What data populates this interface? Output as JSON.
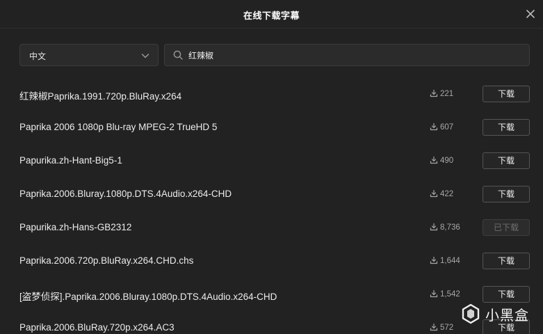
{
  "dialog": {
    "title": "在线下载字幕",
    "close_icon": "close-icon"
  },
  "controls": {
    "language": {
      "selected": "中文",
      "icon": "chevron-down-icon"
    },
    "search": {
      "value": "红辣椒",
      "placeholder": "",
      "icon": "search-icon"
    }
  },
  "results": [
    {
      "name": "红辣椒Paprika.1991.720p.BluRay.x264",
      "downloads": "221",
      "button": "下载",
      "downloaded": false
    },
    {
      "name": "Paprika 2006 1080p Blu-ray MPEG-2 TrueHD 5",
      "downloads": "607",
      "button": "下载",
      "downloaded": false
    },
    {
      "name": "Papurika.zh-Hant-Big5-1",
      "downloads": "490",
      "button": "下载",
      "downloaded": false
    },
    {
      "name": "Paprika.2006.Bluray.1080p.DTS.4Audio.x264-CHD",
      "downloads": "422",
      "button": "下载",
      "downloaded": false
    },
    {
      "name": "Papurika.zh-Hans-GB2312",
      "downloads": "8,736",
      "button": "已下载",
      "downloaded": true
    },
    {
      "name": "Paprika.2006.720p.BluRay.x264.CHD.chs",
      "downloads": "1,644",
      "button": "下载",
      "downloaded": false
    },
    {
      "name": "[盗梦侦探].Paprika.2006.Bluray.1080p.DTS.4Audio.x264-CHD",
      "downloads": "1,542",
      "button": "下载",
      "downloaded": false
    },
    {
      "name": "Paprika.2006.BluRay.720p.x264.AC3",
      "downloads": "572",
      "button": "下载",
      "downloaded": false
    }
  ],
  "watermark": {
    "text": "小黑盒",
    "icon": "xiaoheihe-logo-icon"
  },
  "colors": {
    "background": "#222222",
    "border": "#3c3c3c",
    "button_border": "#555555",
    "disabled_text": "#6e6e6e"
  }
}
